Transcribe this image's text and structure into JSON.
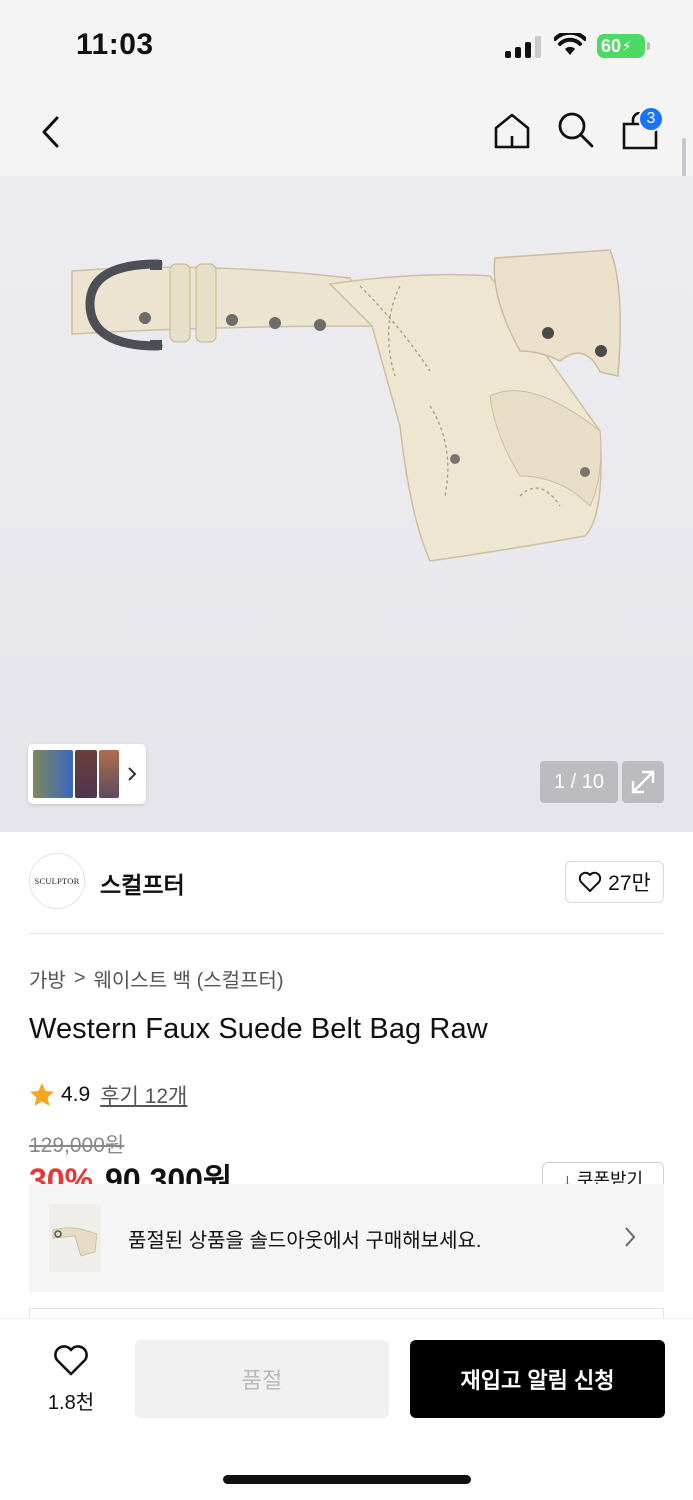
{
  "status_bar": {
    "time": "11:03",
    "battery": "60"
  },
  "nav": {
    "cart_count": "3"
  },
  "gallery": {
    "counter": "1 / 10"
  },
  "brand": {
    "logo_text": "SCULPTOR",
    "name": "스컬프터",
    "likes": "27만"
  },
  "breadcrumb": {
    "category": "가방",
    "separator": ">",
    "subcategory": "웨이스트 백 (스컬프터)"
  },
  "product": {
    "title": "Western Faux Suede Belt Bag Raw",
    "rating": "4.9",
    "reviews": "후기 12개",
    "original_price": "129,000원",
    "discount": "30%",
    "sale_price": "90,300원",
    "coupon_label": "↓ 쿠폰받기"
  },
  "soldout_banner": {
    "text": "품절된 상품을 솔드아웃에서 구매해보세요."
  },
  "bottom_bar": {
    "wish_count": "1.8천",
    "soldout_label": "품절",
    "restock_label": "재입고 알림 신청"
  },
  "colors": {
    "accent": "#1a73ff",
    "sale": "#e53935",
    "star": "#f5a623",
    "battery": "#4cd964"
  }
}
